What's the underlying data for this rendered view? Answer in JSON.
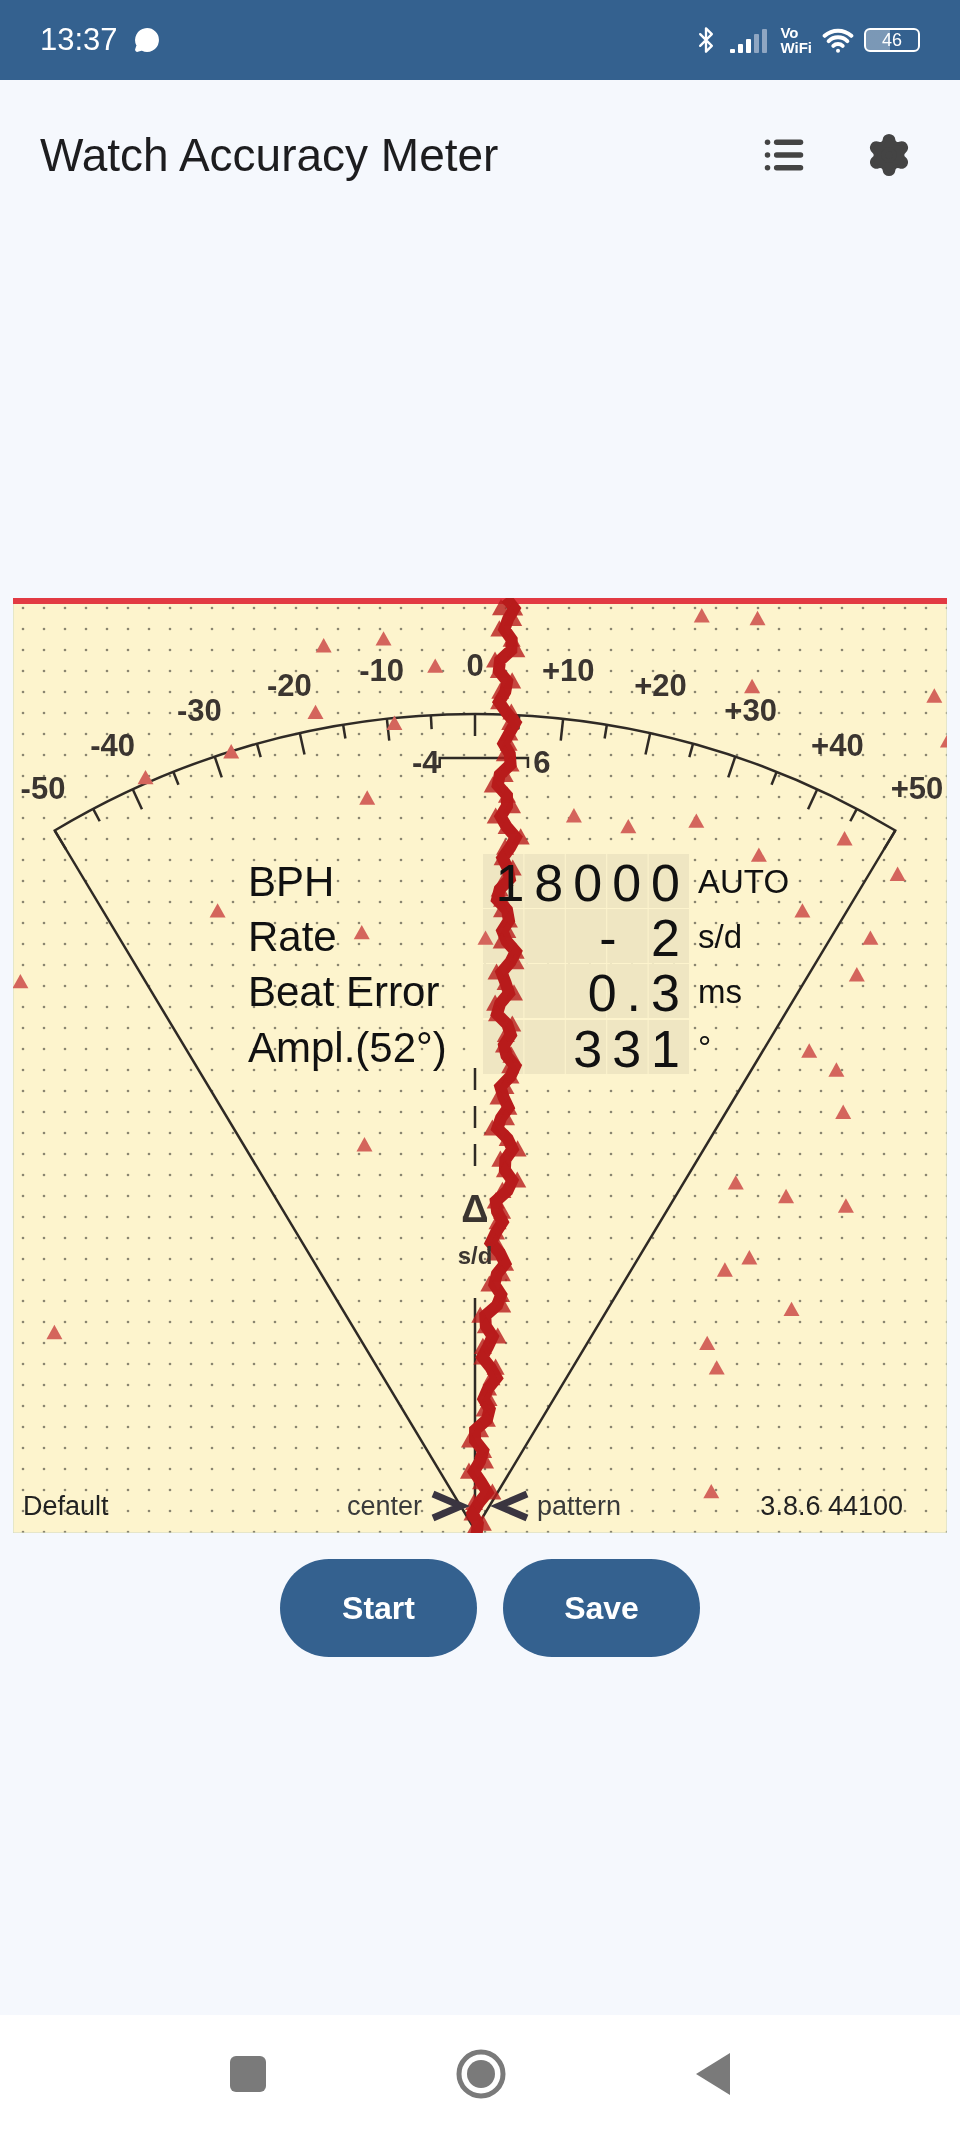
{
  "status_bar": {
    "time": "13:37",
    "network_label_top": "Vo",
    "network_label_bottom": "WiFi",
    "battery": "46"
  },
  "app_bar": {
    "title": "Watch Accuracy Meter"
  },
  "meter": {
    "scale_labels": [
      "-50",
      "-40",
      "-30",
      "-20",
      "-10",
      "0",
      "+10",
      "+20",
      "+30",
      "+40",
      "+50"
    ],
    "tolerance": {
      "low": "-4",
      "high": "6"
    },
    "readings": [
      {
        "label": "BPH",
        "value": "18000",
        "unit": "AUTO"
      },
      {
        "label": "Rate",
        "value": "- 2",
        "unit": "s/d"
      },
      {
        "label": "Beat Error",
        "value": "0.3",
        "unit": "ms"
      },
      {
        "label": "Ampl.(52°)",
        "value": "331",
        "unit": "°"
      }
    ],
    "delta_symbol": "Δ",
    "delta_unit": "s/d",
    "footer": {
      "profile": "Default",
      "left_marker": "center",
      "right_marker": "pattern",
      "version": "3.8.6 44100"
    }
  },
  "buttons": [
    {
      "label": "Start"
    },
    {
      "label": "Save"
    }
  ]
}
